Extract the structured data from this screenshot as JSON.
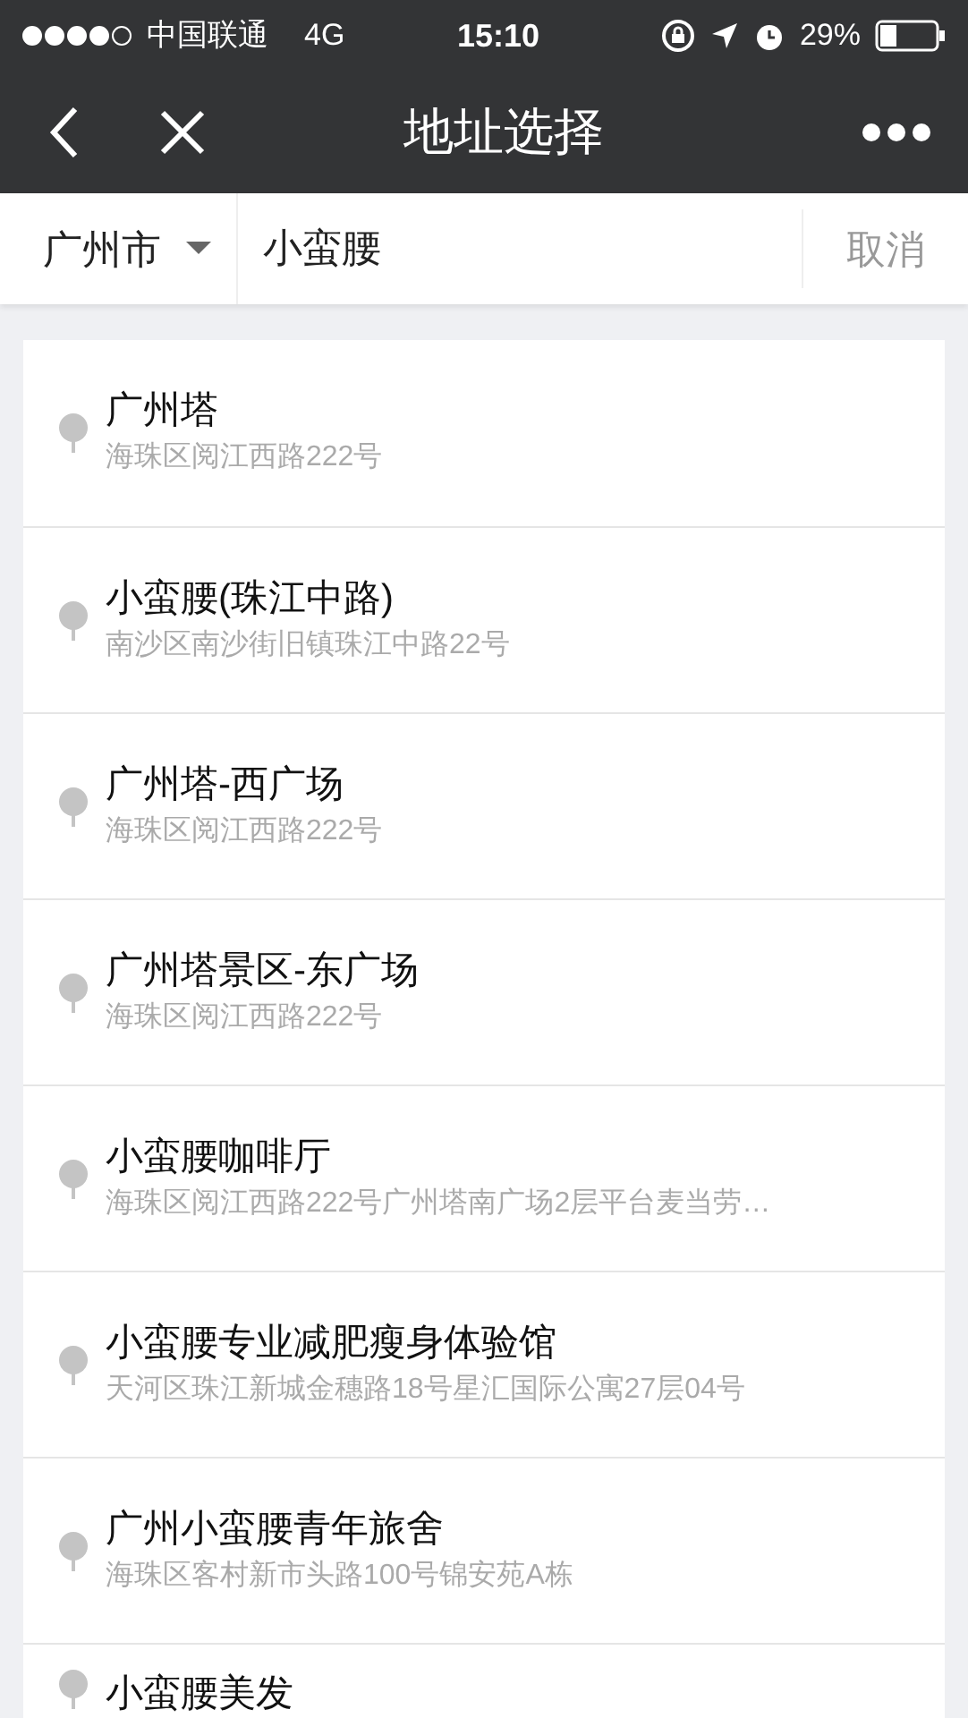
{
  "status_bar": {
    "carrier": "中国联通",
    "network": "4G",
    "time": "15:10",
    "battery": "29%"
  },
  "nav": {
    "title": "地址选择"
  },
  "search": {
    "city": "广州市",
    "value": "小蛮腰",
    "cancel": "取消"
  },
  "results": [
    {
      "name": "广州塔",
      "address": "海珠区阅江西路222号"
    },
    {
      "name": "小蛮腰(珠江中路)",
      "address": "南沙区南沙街旧镇珠江中路22号"
    },
    {
      "name": "广州塔-西广场",
      "address": "海珠区阅江西路222号"
    },
    {
      "name": "广州塔景区-东广场",
      "address": "海珠区阅江西路222号"
    },
    {
      "name": "小蛮腰咖啡厅",
      "address": "海珠区阅江西路222号广州塔南广场2层平台麦当劳…"
    },
    {
      "name": "小蛮腰专业减肥瘦身体验馆",
      "address": "天河区珠江新城金穗路18号星汇国际公寓27层04号"
    },
    {
      "name": "广州小蛮腰青年旅舍",
      "address": "海珠区客村新市头路100号锦安苑A栋"
    },
    {
      "name": "小蛮腰美发"
    }
  ]
}
